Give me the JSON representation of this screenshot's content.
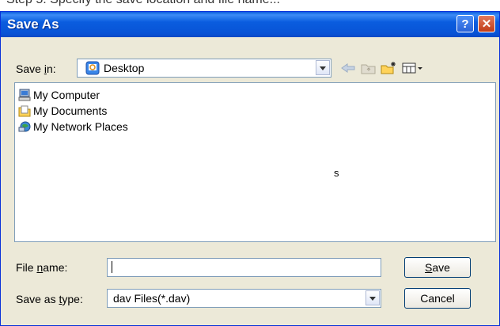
{
  "caption_above": "Step 5: Specify the save location and file name...",
  "dialog": {
    "title": "Save As",
    "help_glyph": "?",
    "close_glyph": "✕",
    "save_in": {
      "label_pre": "Save ",
      "label_key": "i",
      "label_post": "n:",
      "value": "Desktop"
    },
    "toolbar": [
      "back-arrow-icon",
      "up-folder-icon",
      "new-folder-icon",
      "views-menu-icon"
    ],
    "items": [
      {
        "name": "My Computer",
        "icon": "my-computer-icon"
      },
      {
        "name": "My Documents",
        "icon": "my-documents-icon"
      },
      {
        "name": "My Network Places",
        "icon": "my-network-places-icon"
      }
    ],
    "stray_text": "s",
    "file_name": {
      "label_pre": "File ",
      "label_key": "n",
      "label_post": "ame:",
      "value": ""
    },
    "save_type": {
      "label_pre": "Save as ",
      "label_key": "t",
      "label_post": "ype:",
      "value": "dav Files(*.dav)"
    },
    "buttons": {
      "save_key": "S",
      "save_rest": "ave",
      "cancel": "Cancel"
    }
  },
  "colors": {
    "title_bar": "#0a5ddf",
    "dialog_bg": "#ece9d8",
    "close": "#c13b17",
    "help": "#2a63d8"
  }
}
